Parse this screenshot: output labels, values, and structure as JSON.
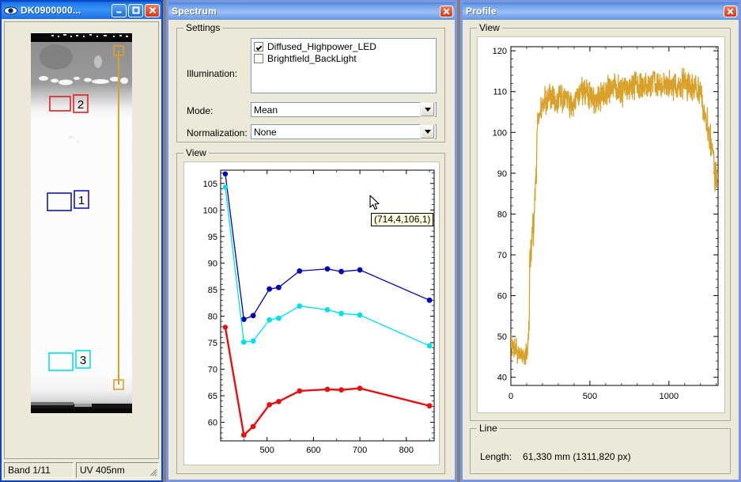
{
  "image_window": {
    "title": "DK0900000...",
    "icon": "eye-icon",
    "minimize_label": "_",
    "maximize_label": "□",
    "close_label": "✕",
    "status": {
      "band": "Band 1/11",
      "wavelength": "UV 405nm"
    },
    "roi_labels": [
      "2",
      "1",
      "3"
    ],
    "roi_colors": [
      "#e02020",
      "#1414c8",
      "#00e0e8"
    ],
    "line_color": "#d9a12a"
  },
  "spectrum_window": {
    "title": "Spectrum",
    "close_label": "✕",
    "settings": {
      "title": "Settings",
      "illumination_label": "Illumination:",
      "illumination_options": [
        {
          "label": "Diffused_Highpower_LED",
          "checked": true
        },
        {
          "label": "Brightfield_BackLight",
          "checked": false
        }
      ],
      "mode_label": "Mode:",
      "mode_value": "Mean",
      "normalization_label": "Normalization:",
      "normalization_value": "None"
    },
    "view": {
      "title": "View",
      "tooltip": "(714,4,106,1)"
    }
  },
  "profile_window": {
    "title": "Profile",
    "close_label": "✕",
    "view": {
      "title": "View"
    },
    "line": {
      "title": "Line",
      "length_label": "Length:",
      "length_value": "61,330 mm (1311,820 px)"
    }
  },
  "chart_data": [
    {
      "type": "line",
      "id": "spectrum-chart",
      "title": "",
      "xlabel": "",
      "ylabel": "",
      "xlim": [
        400,
        860
      ],
      "ylim": [
        56.5,
        107.5
      ],
      "xticks": [
        500,
        600,
        700,
        800
      ],
      "xminorticks": [
        450,
        550,
        650,
        750,
        850
      ],
      "yticks": [
        60,
        65,
        70,
        75,
        80,
        85,
        90,
        95,
        100,
        105
      ],
      "grid": false,
      "legend": "none",
      "markers": true,
      "x": [
        410,
        450,
        470,
        505,
        525,
        570,
        630,
        660,
        700,
        850
      ],
      "series": [
        {
          "name": "region-1",
          "color": "#0000b4",
          "values": [
            106.8,
            79.4,
            80.1,
            85.1,
            85.4,
            88.5,
            88.9,
            88.4,
            88.7,
            83.0
          ]
        },
        {
          "name": "region-3",
          "color": "#00e0e8",
          "values": [
            104.3,
            75.1,
            75.3,
            79.3,
            79.6,
            81.9,
            81.2,
            80.5,
            80.2,
            74.4
          ]
        },
        {
          "name": "region-2",
          "color": "#e81010",
          "values": [
            77.9,
            57.6,
            59.2,
            63.3,
            63.9,
            65.9,
            66.2,
            66.1,
            66.4,
            63.1
          ]
        }
      ]
    },
    {
      "type": "line",
      "id": "profile-chart",
      "title": "",
      "xlabel": "",
      "ylabel": "",
      "xlim": [
        0,
        1311
      ],
      "ylim": [
        38,
        121
      ],
      "xticks": [
        0,
        500,
        1000
      ],
      "yticks": [
        40,
        50,
        60,
        70,
        80,
        90,
        100,
        110,
        120
      ],
      "grid": false,
      "legend": "none",
      "markers": false,
      "series": [
        {
          "name": "intensity-profile",
          "color": "#d9a12a",
          "description": "Noisy intensity trace: low plateau ~46-50 from x=0 to x=110, sharp rise at x~115-160 to ~108, high noisy plateau ~106-114 from x=170 to x=1210, then falls to ~90 at x=1290",
          "x": [
            0,
            10,
            20,
            30,
            40,
            50,
            60,
            70,
            80,
            90,
            100,
            110,
            115,
            120,
            130,
            140,
            150,
            160,
            170,
            200,
            250,
            300,
            350,
            400,
            450,
            500,
            550,
            600,
            650,
            700,
            750,
            800,
            850,
            900,
            950,
            1000,
            1050,
            1100,
            1150,
            1200,
            1230,
            1250,
            1270,
            1290,
            1300,
            1311
          ],
          "values": [
            49,
            48,
            47,
            48,
            46,
            47,
            46,
            45,
            46,
            45,
            46,
            47,
            55,
            68,
            72,
            76,
            80,
            90,
            104,
            107,
            109,
            108,
            108,
            107,
            110,
            109,
            108,
            110,
            111,
            110,
            111,
            112,
            111,
            112,
            111,
            112,
            111,
            112,
            111,
            110,
            104,
            101,
            96,
            90,
            89,
            91
          ]
        }
      ]
    }
  ]
}
